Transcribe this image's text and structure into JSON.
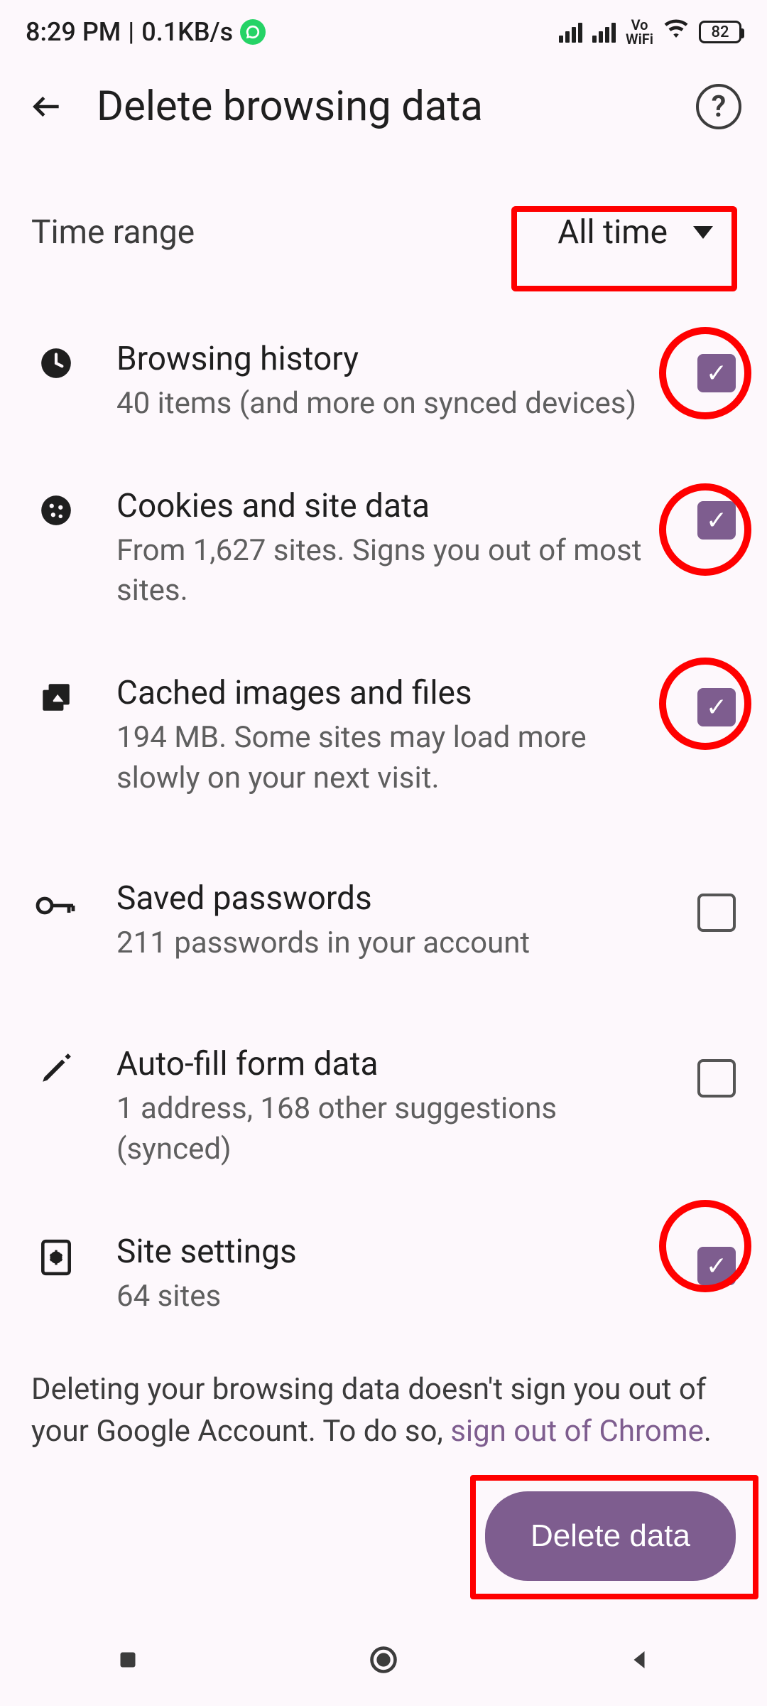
{
  "status_bar": {
    "time": "8:29 PM",
    "separator": "|",
    "data_rate": "0.1KB/s",
    "vowifi": "Vo\nWiFi",
    "battery": "82"
  },
  "header": {
    "title": "Delete browsing data"
  },
  "time_range": {
    "label": "Time range",
    "selected": "All time"
  },
  "items": [
    {
      "title": "Browsing history",
      "subtitle": "40 items (and more on synced devices)",
      "checked": true,
      "highlighted": true
    },
    {
      "title": "Cookies and site data",
      "subtitle": "From 1,627 sites. Signs you out of most sites.",
      "checked": true,
      "highlighted": true
    },
    {
      "title": "Cached images and files",
      "subtitle": "194 MB. Some sites may load more slowly on your next visit.",
      "checked": true,
      "highlighted": true
    },
    {
      "title": "Saved passwords",
      "subtitle": "211 passwords in your account",
      "checked": false,
      "highlighted": false
    },
    {
      "title": "Auto-fill form data",
      "subtitle": "1 address, 168 other suggestions (synced)",
      "checked": false,
      "highlighted": false
    },
    {
      "title": "Site settings",
      "subtitle": "64 sites",
      "checked": true,
      "highlighted": true
    }
  ],
  "footer": {
    "text_before": "Deleting your browsing data doesn't sign you out of your Google Account. To do so, ",
    "link_text": "sign out of Chrome",
    "text_after": "."
  },
  "action": {
    "delete_label": "Delete data"
  }
}
